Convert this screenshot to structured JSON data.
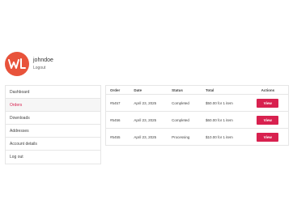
{
  "user": {
    "name": "johndoe",
    "logout_link": "Logout"
  },
  "nav": {
    "items": [
      {
        "label": "Dashboard"
      },
      {
        "label": "Orders"
      },
      {
        "label": "Downloads"
      },
      {
        "label": "Addresses"
      },
      {
        "label": "Account details"
      },
      {
        "label": "Log out"
      }
    ],
    "active_index": 1
  },
  "orders_table": {
    "headers": {
      "order": "Order",
      "date": "Date",
      "status": "Status",
      "total": "Total",
      "actions": "Actions"
    },
    "rows": [
      {
        "order": "#5457",
        "date": "April 23, 2025",
        "status": "Completed",
        "total": "$50.00 for 1 item",
        "action": "View"
      },
      {
        "order": "#5456",
        "date": "April 23, 2025",
        "status": "Completed",
        "total": "$60.00 for 1 item",
        "action": "View"
      },
      {
        "order": "#5455",
        "date": "April 23, 2025",
        "status": "Processing",
        "total": "$10.00 for 1 item",
        "action": "View"
      }
    ]
  },
  "colors": {
    "accent": "#d8214f",
    "avatar": "#e8533b"
  }
}
